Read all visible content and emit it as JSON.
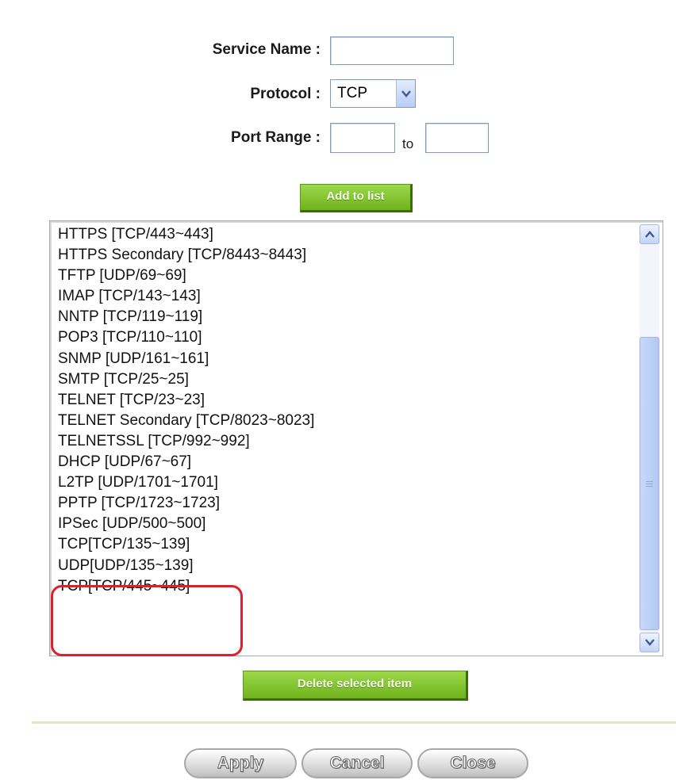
{
  "form": {
    "service_name_label": "Service Name :",
    "service_name_value": "",
    "protocol_label": "Protocol :",
    "protocol_value": "TCP",
    "port_range_label": "Port Range :",
    "port_from_value": "",
    "port_to_label": "to",
    "port_to_value": "",
    "add_button": "Add to list"
  },
  "services": [
    "HTTPS [TCP/443~443]",
    "HTTPS Secondary [TCP/8443~8443]",
    "TFTP [UDP/69~69]",
    "IMAP [TCP/143~143]",
    "NNTP [TCP/119~119]",
    "POP3 [TCP/110~110]",
    "SNMP [UDP/161~161]",
    "SMTP [TCP/25~25]",
    "TELNET [TCP/23~23]",
    "TELNET Secondary [TCP/8023~8023]",
    "TELNETSSL [TCP/992~992]",
    "DHCP [UDP/67~67]",
    "L2TP [UDP/1701~1701]",
    "PPTP [TCP/1723~1723]",
    "IPSec [UDP/500~500]",
    "TCP[TCP/135~139]",
    "UDP[UDP/135~139]",
    "TCP[TCP/445~445]"
  ],
  "actions": {
    "delete_button": "Delete selected item",
    "apply": "Apply",
    "cancel": "Cancel",
    "close": "Close"
  },
  "colors": {
    "accent_green": "#7cc22a",
    "highlight_red": "#e01f2d",
    "scroll_blue": "#b9cdf6"
  },
  "icons": {
    "protocol_dropdown": "chevron-down-icon",
    "scroll_up": "chevron-up-icon",
    "scroll_down": "chevron-down-icon"
  }
}
